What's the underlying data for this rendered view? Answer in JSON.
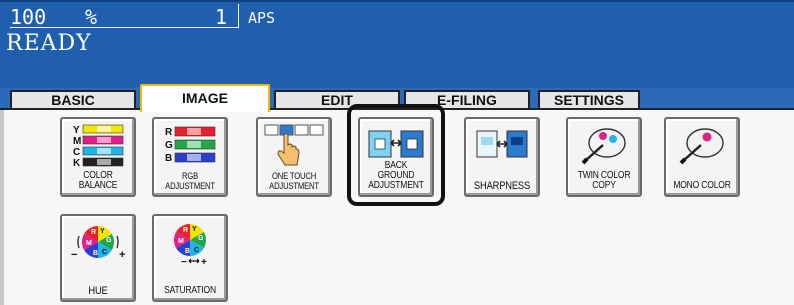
{
  "status": {
    "zoom_value": "100",
    "zoom_unit": "%",
    "copies": "1",
    "paper_mode": "APS",
    "message": "READY"
  },
  "tabs": [
    {
      "label": "BASIC"
    },
    {
      "label": "IMAGE"
    },
    {
      "label": "EDIT"
    },
    {
      "label": "E-FILING"
    },
    {
      "label": "SETTINGS"
    }
  ],
  "active_tab": "IMAGE",
  "buttons": {
    "color_balance": {
      "label": "COLOR BALANCE",
      "rows": [
        "Y",
        "M",
        "C",
        "K"
      ]
    },
    "rgb_adjustment": {
      "label_1": "RGB",
      "label_2": "ADJUSTMENT",
      "rows": [
        "R",
        "G",
        "B"
      ]
    },
    "one_touch": {
      "label_1": "ONE TOUCH",
      "label_2": "ADJUSTMENT"
    },
    "background": {
      "label_1": "BACK GROUND",
      "label_2": "ADJUSTMENT"
    },
    "sharpness": {
      "label": "SHARPNESS"
    },
    "twin_color": {
      "label_1": "TWIN COLOR",
      "label_2": "COPY"
    },
    "mono_color": {
      "label": "MONO COLOR"
    },
    "hue": {
      "label": "HUE",
      "wheel_letters": [
        "R",
        "Y",
        "G",
        "C",
        "B",
        "M"
      ],
      "minus": "−",
      "plus": "+"
    },
    "saturation": {
      "label": "SATURATION",
      "wheel_letters": [
        "R",
        "Y",
        "G",
        "C",
        "B",
        "M"
      ],
      "minus": "−",
      "plus": "+"
    }
  },
  "colors": {
    "header_blue": "#1f5fae",
    "tab_active_border": "#f0b800",
    "yellow": "#f2e600",
    "magenta": "#e0208a",
    "cyan": "#1fb5e8",
    "black": "#222222",
    "red": "#e8202a",
    "green": "#22a84a",
    "blue": "#2a3fd0"
  }
}
